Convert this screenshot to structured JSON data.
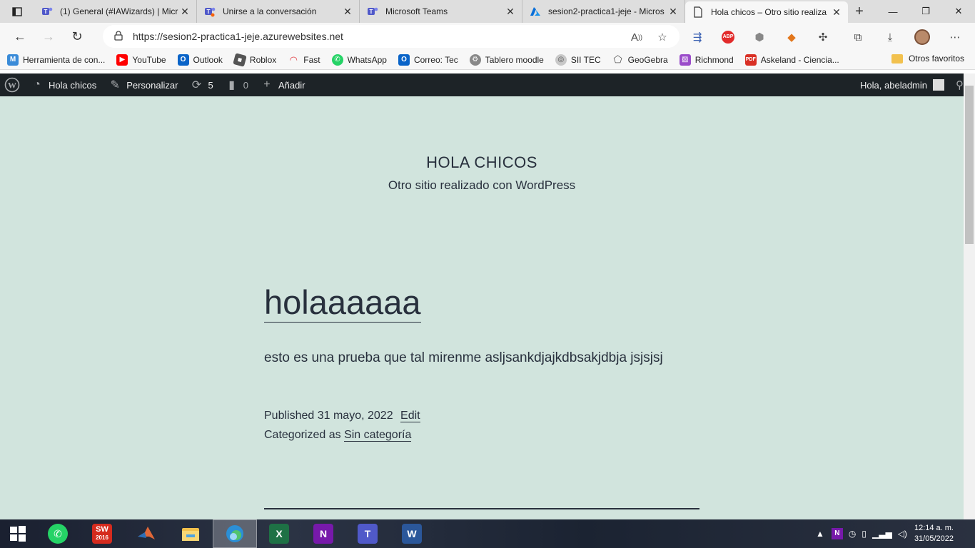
{
  "tabs": [
    {
      "title": "(1) General (#IAWizards) | Micr",
      "icon": "teams-icon"
    },
    {
      "title": "Unirse a la conversación",
      "icon": "teams-icon"
    },
    {
      "title": "Microsoft Teams",
      "icon": "teams-icon"
    },
    {
      "title": "sesion2-practica1-jeje - Micros",
      "icon": "azure-icon"
    },
    {
      "title": "Hola chicos – Otro sitio realiza",
      "icon": "page-icon",
      "active": true
    }
  ],
  "address": {
    "url": "https://sesion2-practica1-jeje.azurewebsites.net"
  },
  "extensions": {
    "abp": "ABP"
  },
  "bookmarks": [
    {
      "label": "Herramienta de con...",
      "icon": "m-icon",
      "color": "#3a8bd8"
    },
    {
      "label": "YouTube",
      "icon": "youtube-icon",
      "color": "#ff0000"
    },
    {
      "label": "Outlook",
      "icon": "outlook-icon",
      "color": "#0a64c8"
    },
    {
      "label": "Roblox",
      "icon": "roblox-icon",
      "color": "#555555"
    },
    {
      "label": "Fast",
      "icon": "fast-icon",
      "color": "#e0383e"
    },
    {
      "label": "WhatsApp",
      "icon": "whatsapp-icon",
      "color": "#25d366"
    },
    {
      "label": "Correo: Tec",
      "icon": "outlook-icon",
      "color": "#0a64c8"
    },
    {
      "label": "Tablero moodle",
      "icon": "moodle-icon",
      "color": "#888888"
    },
    {
      "label": "SII TEC",
      "icon": "sii-icon",
      "color": "#a0a0a0"
    },
    {
      "label": "GeoGebra",
      "icon": "geogebra-icon",
      "color": "#666666"
    },
    {
      "label": "Richmond",
      "icon": "richmond-icon",
      "color": "#9b4dca"
    },
    {
      "label": "Askeland - Ciencia...",
      "icon": "pdf-icon",
      "color": "#d93025"
    }
  ],
  "other_favorites": "Otros favoritos",
  "wpbar": {
    "site": "Hola chicos",
    "customize": "Personalizar",
    "updates": "5",
    "comments": "0",
    "add_new": "Añadir",
    "greeting": "Hola, abeladmin"
  },
  "site": {
    "title": "HOLA CHICOS",
    "description": "Otro sitio realizado con WordPress"
  },
  "post": {
    "title": "holaaaaaa",
    "body": "esto es una prueba que tal mirenme asljsankdjajkdbsakjdbja jsjsjsj",
    "published_label": "Published",
    "date": "31 mayo, 2022",
    "edit": "Edit",
    "categorized_label": "Categorized as",
    "category": "Sin categoría"
  },
  "taskbar": {
    "apps": [
      {
        "name": "whatsapp",
        "text": "",
        "color": "#25d366"
      },
      {
        "name": "solidworks",
        "text": "SW",
        "color": "#d52b1e"
      },
      {
        "name": "matlab",
        "text": "",
        "color": "#e16737"
      },
      {
        "name": "file-explorer",
        "text": "",
        "color": "#f3c14b"
      },
      {
        "name": "edge",
        "text": "",
        "color": "#2b8fd6"
      },
      {
        "name": "excel",
        "text": "X",
        "color": "#1e7145"
      },
      {
        "name": "onenote",
        "text": "N",
        "color": "#7719aa"
      },
      {
        "name": "teams",
        "text": "T",
        "color": "#5059c9"
      },
      {
        "name": "word",
        "text": "W",
        "color": "#2b579a"
      }
    ],
    "solidworks_year": "2016",
    "time": "12:14 a. m.",
    "date": "31/05/2022"
  }
}
